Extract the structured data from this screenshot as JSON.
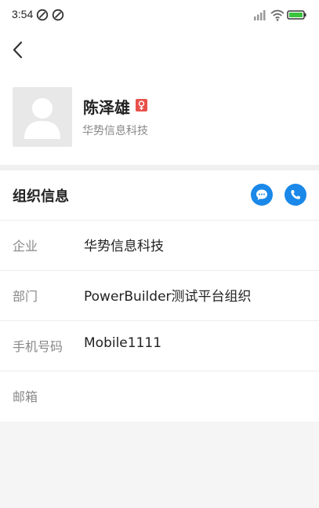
{
  "status_bar": {
    "time": "3:54"
  },
  "profile": {
    "name": "陈泽雄",
    "company": "华势信息科技",
    "gender_color": "#e8504a"
  },
  "org_info": {
    "title": "组织信息",
    "accent_color": "#1a88e8",
    "rows": [
      {
        "label": "企业",
        "value": "华势信息科技"
      },
      {
        "label": "部门",
        "value": "PowerBuilder测试平台组织"
      },
      {
        "label": "手机号码",
        "value": "Mobile1111"
      },
      {
        "label": "邮箱",
        "value": ""
      }
    ]
  }
}
